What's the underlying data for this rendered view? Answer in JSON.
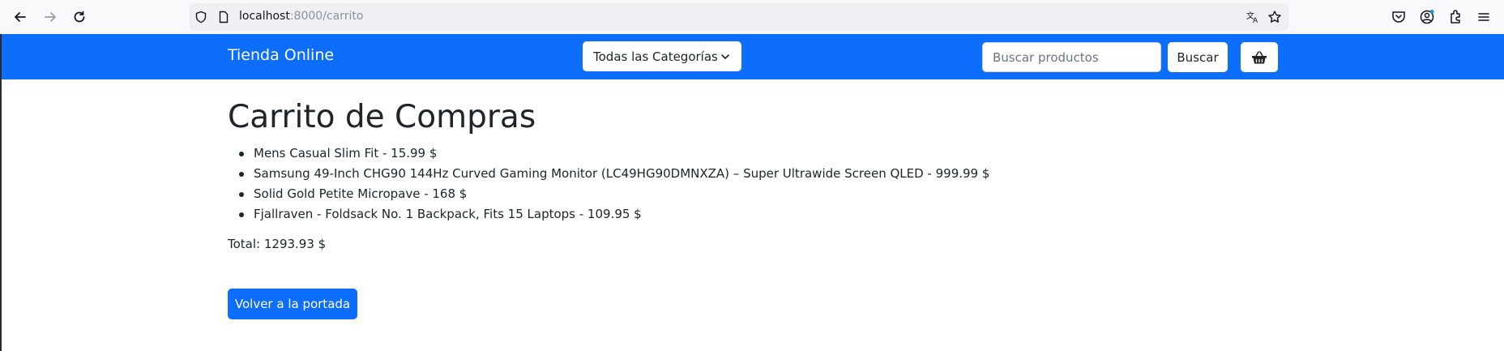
{
  "browser": {
    "url_host": "localhost",
    "url_path": ":8000/carrito"
  },
  "navbar": {
    "brand": "Tienda Online",
    "category_label": "Todas las Categorías",
    "search_placeholder": "Buscar productos",
    "search_button": "Buscar",
    "cart_icon": "basket-icon"
  },
  "main": {
    "title": "Carrito de Compras",
    "items": [
      "Mens Casual Slim Fit - 15.99 $",
      "Samsung 49-Inch CHG90 144Hz Curved Gaming Monitor (LC49HG90DMNXZA) – Super Ultrawide Screen QLED - 999.99 $",
      "Solid Gold Petite Micropave - 168 $",
      "Fjallraven - Foldsack No. 1 Backpack, Fits 15 Laptops - 109.95 $"
    ],
    "total": "Total: 1293.93 $",
    "back_button": "Volver a la portada"
  },
  "colors": {
    "navbar_bg": "#0d6efd",
    "button_primary": "#0d6efd"
  }
}
